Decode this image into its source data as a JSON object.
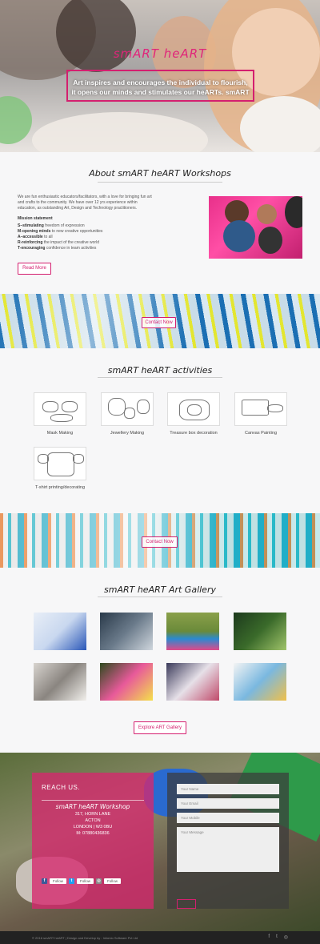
{
  "hero": {
    "title": "smART heART",
    "tagline": "Art inspires and encourages the individual to flourish, it opens our minds and stimulates our heARTs.  smART"
  },
  "about": {
    "title": "About smART heART Workshops",
    "intro": "We are fun enthusiastic educators/facilitators, with a love for bringing fun art and crafts to the community. We have over 12 yrs experience within education, as outstanding Art, Design and Technology practitioners.",
    "mission_heading": "Mission statement",
    "mission": [
      {
        "key": "S–stimulating",
        "rest": " freedom of expression"
      },
      {
        "key": "M-opening minds",
        "rest": " to new creative opportunities"
      },
      {
        "key": "A–accessible",
        "rest": " to all"
      },
      {
        "key": "R-reinforcing",
        "rest": " the impact of the creative world"
      },
      {
        "key": "T-encouraging",
        "rest": " confidence in team activities"
      }
    ],
    "read_more": "Read More"
  },
  "banner1": {
    "button": "Contact Now"
  },
  "activities": {
    "title": "smART heART activities",
    "items": [
      {
        "label": "Mask Making",
        "icon": "mask-sketch"
      },
      {
        "label": "Jewellery Making",
        "icon": "jewellery-sketch"
      },
      {
        "label": "Treasure box decoration",
        "icon": "treasure-box-sketch"
      },
      {
        "label": "Canvas Painting",
        "icon": "canvas-sketch"
      },
      {
        "label": "T-shirt printing/decorating",
        "icon": "tshirt-sketch"
      }
    ]
  },
  "banner2": {
    "button": "Contact Now"
  },
  "gallery": {
    "title": "smART heART Art Gallery",
    "button": "Explore ART Gallery"
  },
  "contact": {
    "heading": "REACH US.",
    "org": "smART heART Workshop",
    "address": [
      "317, HORN LANE",
      "ACTON",
      "LONDON | W3 0BU",
      "M: 07880436836"
    ],
    "social": [
      {
        "icon": "facebook-icon",
        "label": "Follow",
        "color": "#3b5998",
        "glyph": "f"
      },
      {
        "icon": "twitter-icon",
        "label": "Follow",
        "color": "#1da1f2",
        "glyph": "t"
      },
      {
        "icon": "instagram-icon",
        "label": "Follow",
        "color": "#8a8a8a",
        "glyph": "◎"
      }
    ],
    "form": {
      "name_placeholder": "Your Name",
      "email_placeholder": "Your Email",
      "mobile_placeholder": "Your Mobile",
      "message_placeholder": "Your Message"
    }
  },
  "footer": {
    "copyright": "© 2016 smART heART  |  Design and Develop by : Infomio Software Pvt Ltd"
  },
  "colors": {
    "accent": "#d41f6f"
  }
}
